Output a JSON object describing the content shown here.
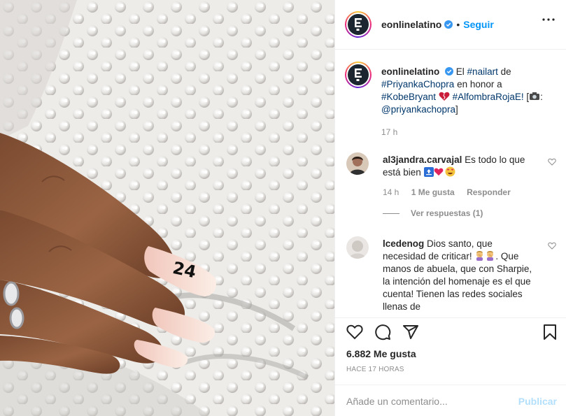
{
  "post": {
    "account": "eonlinelatino",
    "follow_label": "Seguir",
    "separator": "•",
    "logo_letter": "E"
  },
  "caption": {
    "username": "eonlinelatino",
    "text_1": " El ",
    "tag_nailart": "#nailart",
    "text_2": " de ",
    "tag_priyanka": "#PriyankaChopra",
    "text_3": " en honor a ",
    "tag_kobe": "#KobeBryant",
    "text_4": " ",
    "tag_alfombra": "#AlfombraRojaE!",
    "text_5": " [",
    "mention": "@priyankachopra",
    "text_6": "]",
    "time": "17 h"
  },
  "comments": [
    {
      "username": "al3jandra.carvajal",
      "text": " Es todo lo que está bien ",
      "time": "14 h",
      "likes": "1 Me gusta",
      "reply": "Responder",
      "view_replies": "Ver respuestas (1)"
    },
    {
      "username": "lcedenog",
      "text_1": " Dios santo, que necesidad de criticar! ",
      "text_2": ". Que manos de abuela, que con Sharpie, la intención del homenaje es el que cuenta! Tienen las redes sociales llenas de"
    }
  ],
  "photo": {
    "nail_number": "24"
  },
  "footer": {
    "likes": "6.882 Me gusta",
    "posted": "HACE 17 HORAS",
    "comment_placeholder": "Añade un comentario...",
    "publish_label": "Publicar"
  },
  "icons": {
    "like": "heart-icon",
    "comment": "comment-icon",
    "share": "share-icon",
    "save": "bookmark-icon",
    "more": "more-icon",
    "verified": "verified-badge-icon"
  },
  "colors": {
    "link_blue": "#0095f6",
    "hashtag": "#00376b",
    "muted": "#8e8e8e",
    "publish_disabled": "#b2dffc",
    "text": "#262626"
  }
}
